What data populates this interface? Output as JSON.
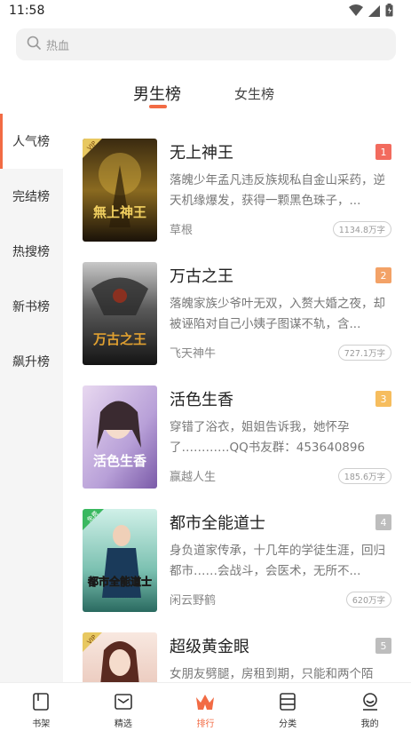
{
  "status": {
    "time": "11:58"
  },
  "search": {
    "placeholder": "热血"
  },
  "gender_tabs": [
    {
      "label": "男生榜",
      "active": true
    },
    {
      "label": "女生榜",
      "active": false
    }
  ],
  "sidebar": {
    "items": [
      {
        "label": "人气榜",
        "active": true
      },
      {
        "label": "完结榜",
        "active": false
      },
      {
        "label": "热搜榜",
        "active": false
      },
      {
        "label": "新书榜",
        "active": false
      },
      {
        "label": "飙升榜",
        "active": false
      }
    ]
  },
  "books": [
    {
      "rank": "1",
      "title": "无上神王",
      "desc": "落魄少年孟凡违反族规私自金山采药，逆天机缘爆发，获得一颗黑色珠子，...",
      "author": "草根",
      "words": "1134.8万字",
      "badge_color": "#f26b5e",
      "cover_text": "無上神王",
      "cover_tag": "VIP"
    },
    {
      "rank": "2",
      "title": "万古之王",
      "desc": "落魄家族少爷叶无双，入赘大婚之夜，却被诬陷对自己小姨子图谋不轨，含...",
      "author": "飞天神牛",
      "words": "727.1万字",
      "badge_color": "#f3a267",
      "cover_text": "万古之王",
      "cover_tag": ""
    },
    {
      "rank": "3",
      "title": "活色生香",
      "desc": "穿错了浴衣，姐姐告诉我，她怀孕了…………QQ书友群：453640896（有...",
      "author": "赢越人生",
      "words": "185.6万字",
      "badge_color": "#f6bd5e",
      "cover_text": "活色生香",
      "cover_tag": ""
    },
    {
      "rank": "4",
      "title": "都市全能道士",
      "desc": "身负道家传承，十几年的学徒生涯，回归都市……会战斗，会医术，无所不...",
      "author": "闲云野鹤",
      "words": "620万字",
      "badge_color": "#bdbdbd",
      "cover_text": "都市全能道士",
      "cover_tag": "免费"
    },
    {
      "rank": "5",
      "title": "超级黄金眼",
      "desc": "女朋友劈腿，房租到期，只能和两个陌",
      "author": "",
      "words": "",
      "badge_color": "#bdbdbd",
      "cover_text": "",
      "cover_tag": "VIP"
    }
  ],
  "bottom_nav": [
    {
      "label": "书架",
      "icon": "bookshelf-icon",
      "active": false
    },
    {
      "label": "精选",
      "icon": "inbox-icon",
      "active": false
    },
    {
      "label": "排行",
      "icon": "crown-icon",
      "active": true
    },
    {
      "label": "分类",
      "icon": "category-icon",
      "active": false
    },
    {
      "label": "我的",
      "icon": "profile-icon",
      "active": false
    }
  ],
  "colors": {
    "accent": "#f26b44",
    "sidebar_bg": "#f5f5f5"
  }
}
